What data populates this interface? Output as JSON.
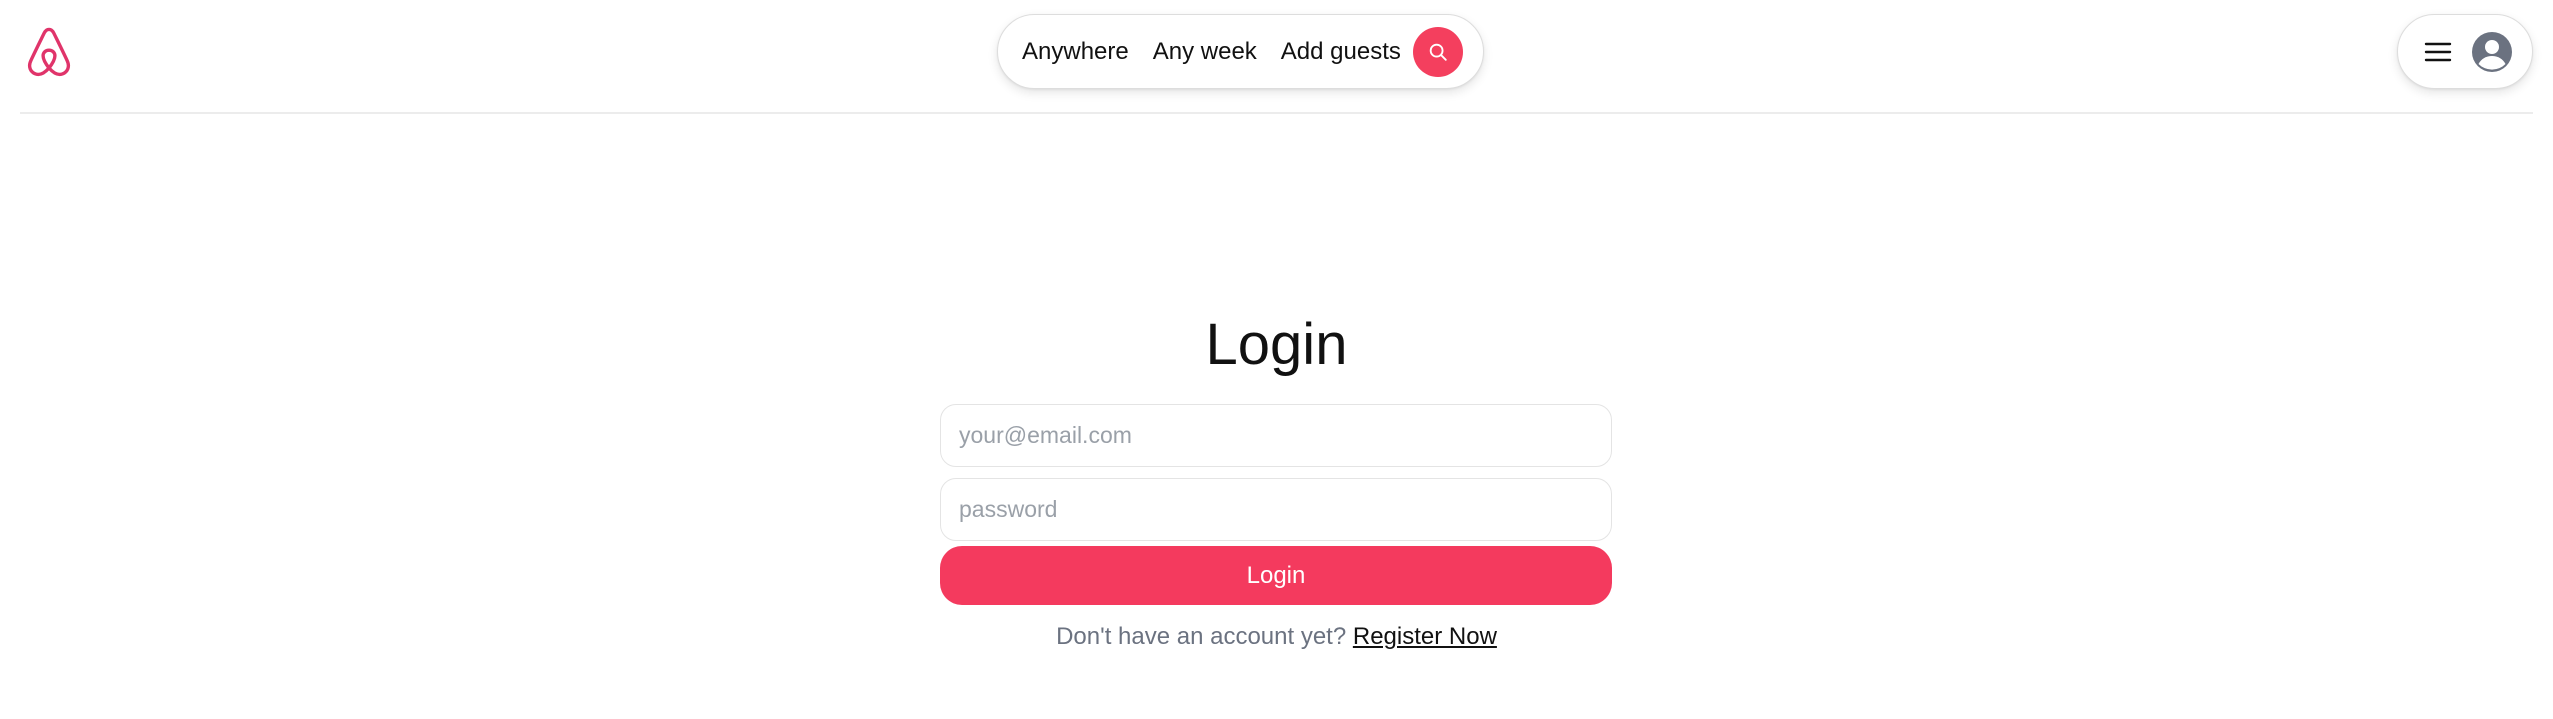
{
  "brand": {
    "logo_icon": "airbnb-logo-icon",
    "accent_color": "#f43f5e"
  },
  "header": {
    "search": {
      "location_label": "Anywhere",
      "dates_label": "Any week",
      "guests_label": "Add guests",
      "search_icon": "search-icon"
    },
    "user_menu": {
      "menu_icon": "hamburger-menu-icon",
      "avatar_icon": "user-avatar-icon"
    }
  },
  "login": {
    "title": "Login",
    "email_placeholder": "your@email.com",
    "email_value": "",
    "password_placeholder": "password",
    "password_value": "",
    "submit_label": "Login",
    "register_prompt": "Don't have an account yet?",
    "register_link": "Register Now"
  }
}
